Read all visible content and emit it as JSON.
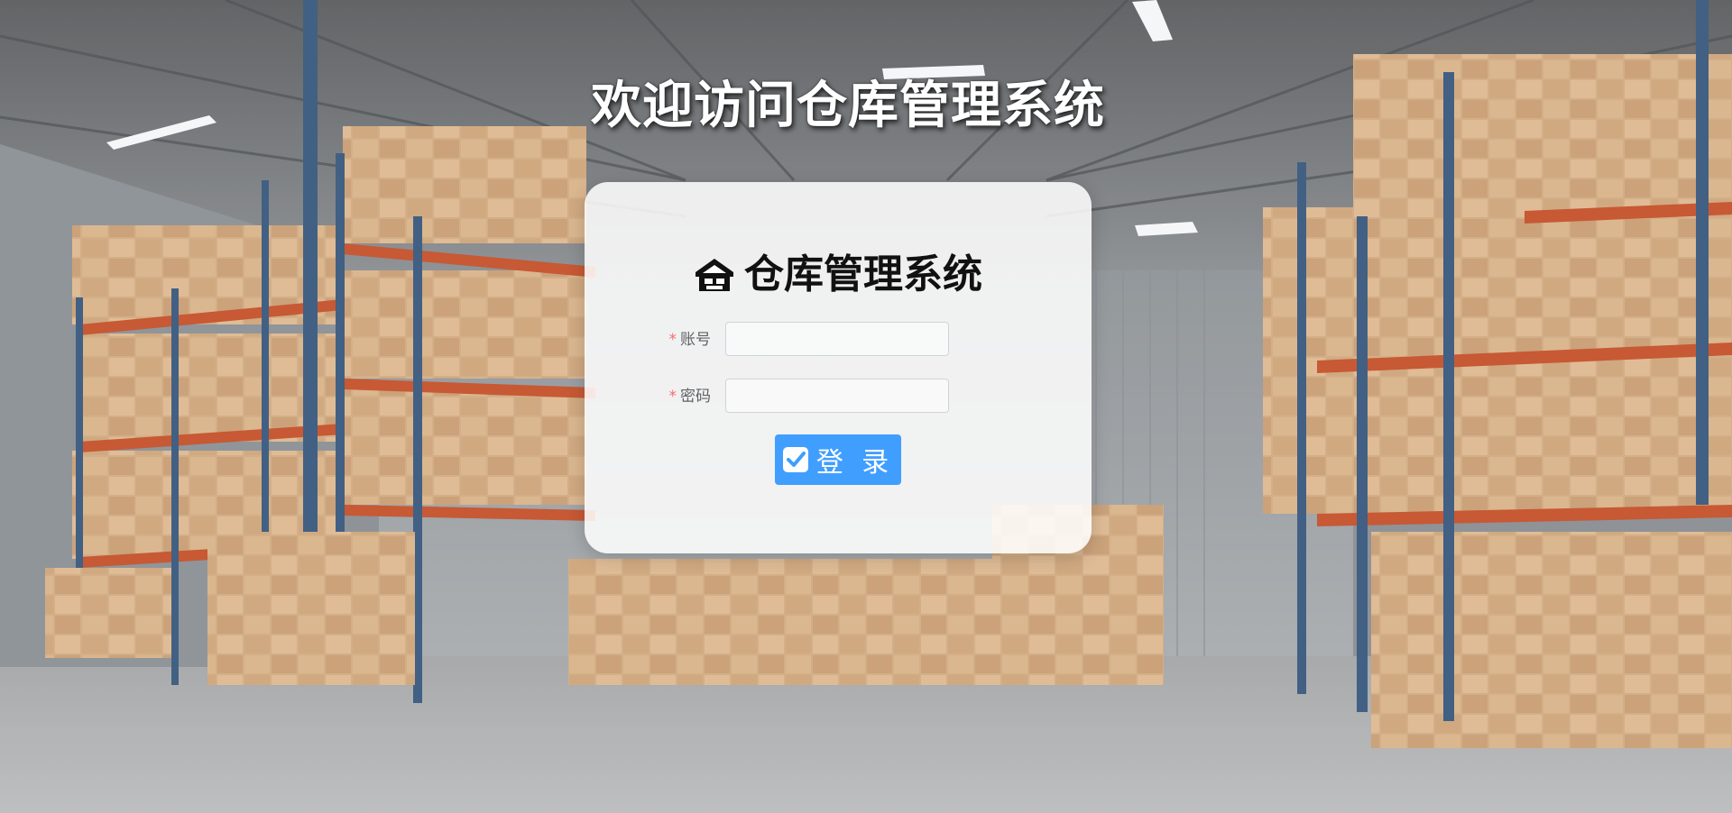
{
  "page": {
    "welcome_title": "欢迎访问仓库管理系统"
  },
  "login": {
    "icon": "warehouse-icon",
    "title": "仓库管理系统",
    "fields": [
      {
        "label": "账号",
        "required_mark": "*",
        "value": "",
        "placeholder": ""
      },
      {
        "label": "密码",
        "required_mark": "*",
        "value": "",
        "placeholder": ""
      }
    ],
    "submit": {
      "icon": "checkbox-icon",
      "label": "登 录"
    }
  },
  "colors": {
    "primary": "#409eff",
    "required": "#f56c6c",
    "label": "#606266"
  }
}
